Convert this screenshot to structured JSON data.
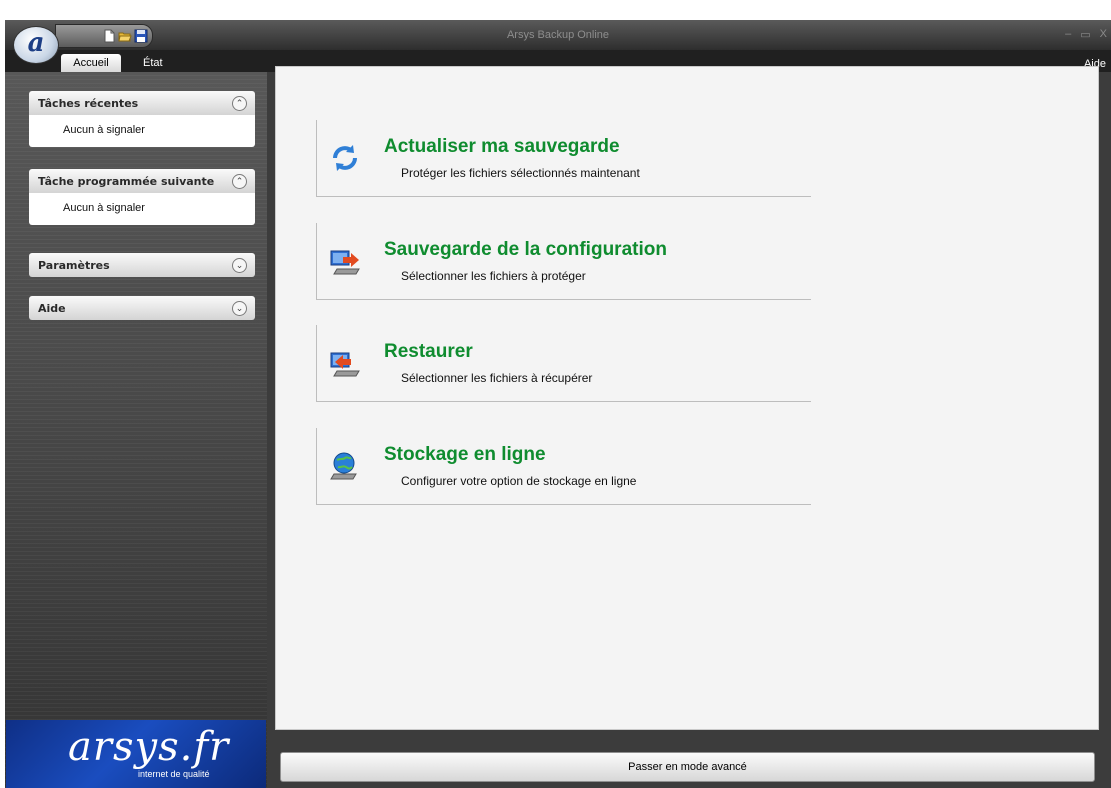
{
  "window": {
    "title": "Arsys Backup Online",
    "controls": [
      "–",
      "▭",
      "X"
    ]
  },
  "app_menu": {
    "glyph": "a"
  },
  "quick_access": [
    "new-file-icon",
    "open-folder-icon",
    "save-icon"
  ],
  "tabs": [
    {
      "label": "Accueil",
      "active": true
    },
    {
      "label": "État",
      "active": false
    }
  ],
  "help_link": "Aide",
  "sidebar": {
    "panels": [
      {
        "title": "Tâches récentes",
        "expanded": true,
        "content": "Aucun à signaler"
      },
      {
        "title": "Tâche programmée suivante",
        "expanded": true,
        "content": "Aucun à signaler"
      },
      {
        "title": "Paramètres",
        "expanded": false
      },
      {
        "title": "Aide",
        "expanded": false
      }
    ],
    "logo": {
      "text": "arsys.fr",
      "tagline": "internet de qualité"
    }
  },
  "actions": [
    {
      "title": "Actualiser ma sauvegarde",
      "description": "Protéger les fichiers sélectionnés maintenant",
      "icon": "refresh-icon"
    },
    {
      "title": "Sauvegarde de la configuration",
      "description": "Sélectionner les fichiers à protéger",
      "icon": "backup-config-icon"
    },
    {
      "title": "Restaurer",
      "description": "Sélectionner les fichiers à récupérer",
      "icon": "restore-icon"
    },
    {
      "title": "Stockage en ligne",
      "description": "Configurer votre option de stockage en ligne",
      "icon": "online-storage-icon"
    }
  ],
  "footer_button": "Passer en mode avancé",
  "colors": {
    "action_title": "#0f8c2f",
    "logo_blue": "#1a4dbf",
    "chrome_dark": "#3c3c3c"
  }
}
